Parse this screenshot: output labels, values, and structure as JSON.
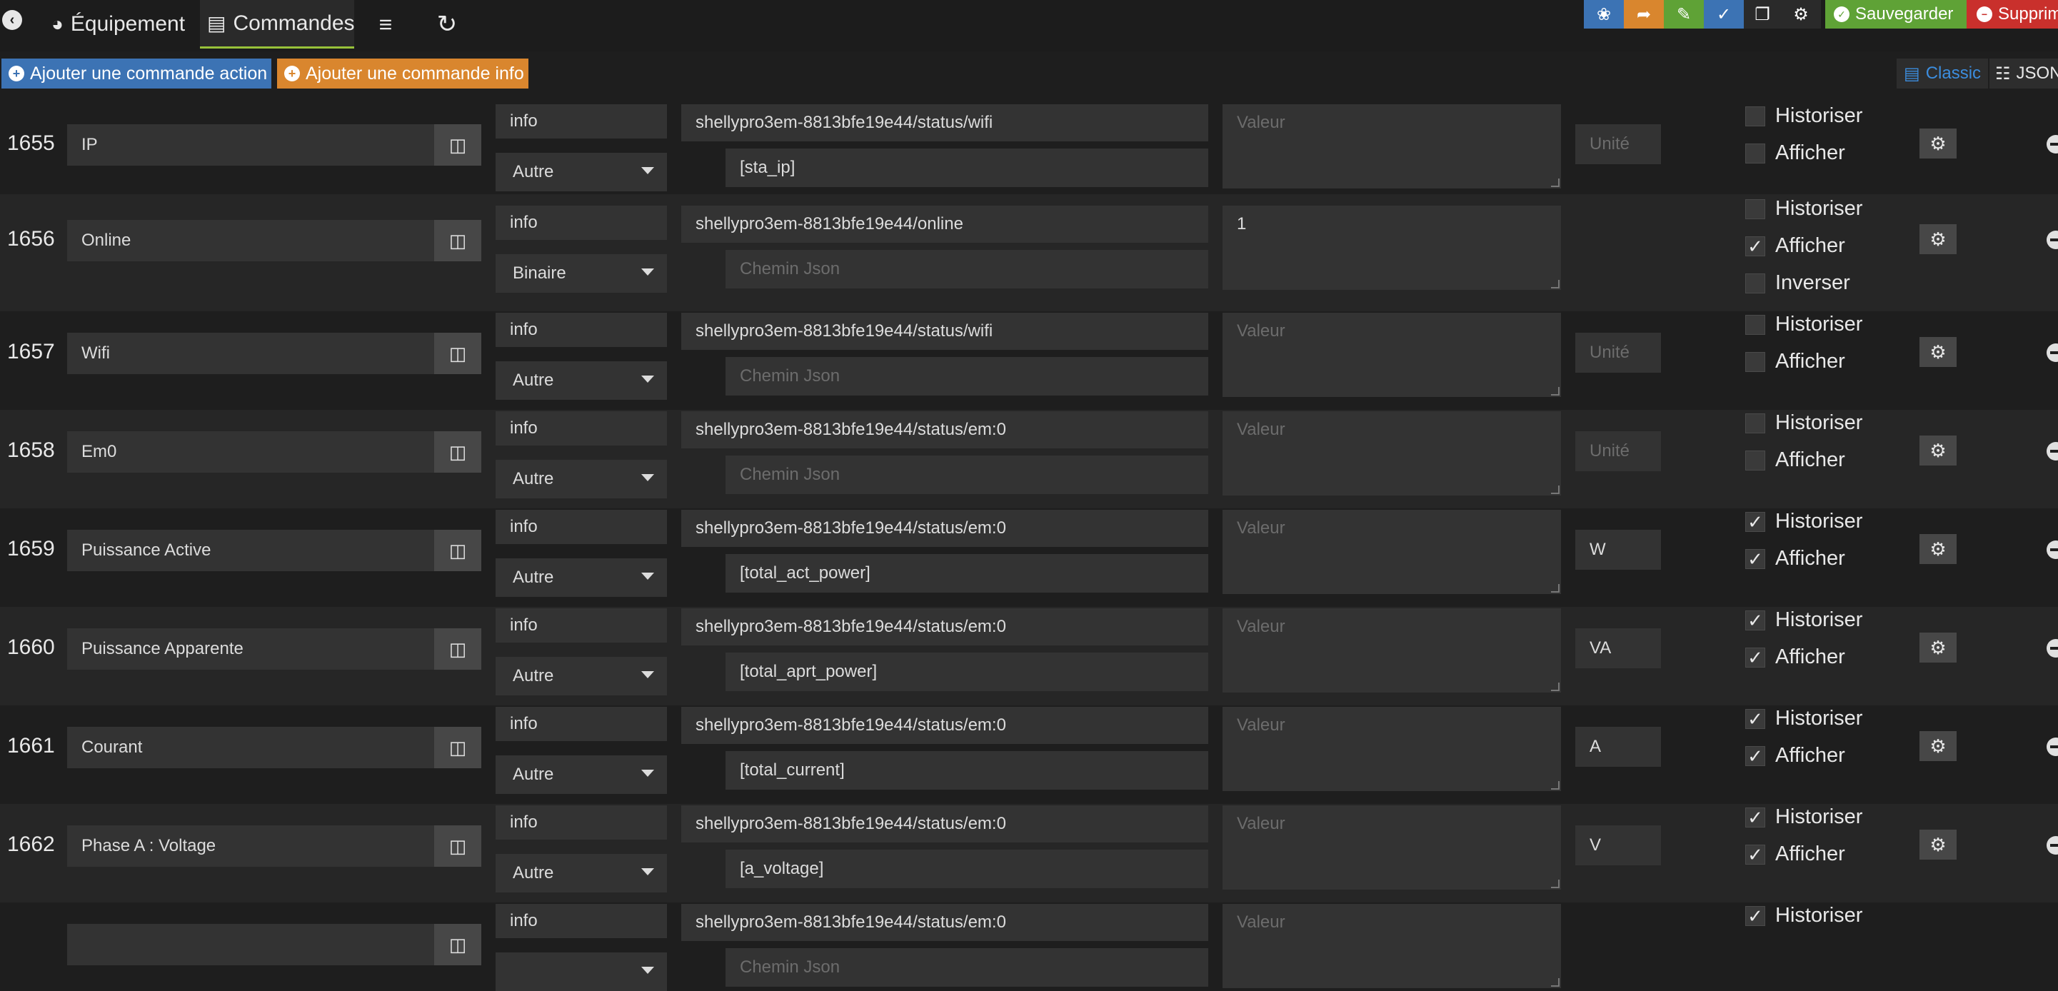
{
  "nav": {
    "back_icon": "arrow-circle-left-icon",
    "tabs": [
      {
        "label": "Équipement",
        "icon": "tachometer-icon"
      },
      {
        "label": "Commandes",
        "icon": "list-alt-icon"
      },
      {
        "label": "",
        "icon": "align-left-icon"
      },
      {
        "label": "",
        "icon": "refresh-icon"
      }
    ]
  },
  "toolbar": {
    "save_label": "Sauvegarder",
    "delete_label": "Supprimer",
    "colors": {
      "blue": "#3c73b4",
      "orange": "#d9862e",
      "green": "#5fa236",
      "red": "#c9302c"
    }
  },
  "actions": {
    "add_action": "Ajouter une commande action",
    "add_info": "Ajouter une commande info",
    "view_classic": "Classic",
    "view_json": "JSON"
  },
  "labels": {
    "historiser": "Historiser",
    "afficher": "Afficher",
    "inverser": "Inverser",
    "valeur_placeholder": "Valeur",
    "unite_placeholder": "Unité",
    "json_placeholder": "Chemin Json"
  },
  "commands": [
    {
      "id": "1655",
      "name": "IP",
      "type": "info",
      "subtype": "Autre",
      "topic": "shellypro3em-8813bfe19e44/status/wifi",
      "json_path": "[sta_ip]",
      "value": "",
      "unit": "",
      "historiser": false,
      "afficher": false
    },
    {
      "id": "1656",
      "name": "Online",
      "type": "info",
      "subtype": "Binaire",
      "topic": "shellypro3em-8813bfe19e44/online",
      "json_path": "",
      "value": "1",
      "unit": null,
      "historiser": false,
      "afficher": true,
      "inverser": false
    },
    {
      "id": "1657",
      "name": "Wifi",
      "type": "info",
      "subtype": "Autre",
      "topic": "shellypro3em-8813bfe19e44/status/wifi",
      "json_path": "",
      "value": "",
      "unit": "",
      "historiser": false,
      "afficher": false
    },
    {
      "id": "1658",
      "name": "Em0",
      "type": "info",
      "subtype": "Autre",
      "topic": "shellypro3em-8813bfe19e44/status/em:0",
      "json_path": "",
      "value": "",
      "unit": "",
      "historiser": false,
      "afficher": false
    },
    {
      "id": "1659",
      "name": "Puissance Active",
      "type": "info",
      "subtype": "Autre",
      "topic": "shellypro3em-8813bfe19e44/status/em:0",
      "json_path": "[total_act_power]",
      "value": "",
      "unit": "W",
      "historiser": true,
      "afficher": true
    },
    {
      "id": "1660",
      "name": "Puissance Apparente",
      "type": "info",
      "subtype": "Autre",
      "topic": "shellypro3em-8813bfe19e44/status/em:0",
      "json_path": "[total_aprt_power]",
      "value": "",
      "unit": "VA",
      "historiser": true,
      "afficher": true
    },
    {
      "id": "1661",
      "name": "Courant",
      "type": "info",
      "subtype": "Autre",
      "topic": "shellypro3em-8813bfe19e44/status/em:0",
      "json_path": "[total_current]",
      "value": "",
      "unit": "A",
      "historiser": true,
      "afficher": true
    },
    {
      "id": "1662",
      "name": "Phase A : Voltage",
      "type": "info",
      "subtype": "Autre",
      "topic": "shellypro3em-8813bfe19e44/status/em:0",
      "json_path": "[a_voltage]",
      "value": "",
      "unit": "V",
      "historiser": true,
      "afficher": true
    },
    {
      "id": "",
      "name": "",
      "type": "info",
      "subtype": "",
      "topic": "shellypro3em-8813bfe19e44/status/em:0",
      "json_path": "",
      "value": "",
      "unit": "",
      "historiser": true,
      "afficher": false
    }
  ]
}
